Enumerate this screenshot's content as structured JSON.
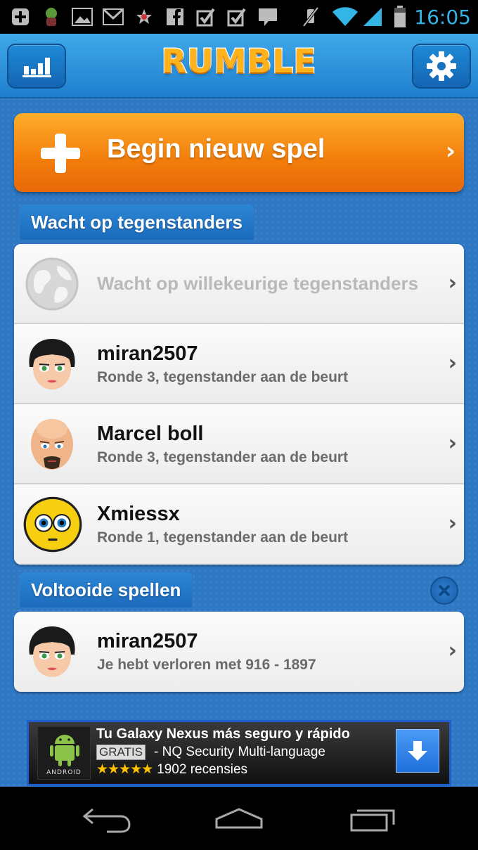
{
  "status_bar": {
    "time": "16:05",
    "icons": [
      "add-icon",
      "bug-icon",
      "image-icon",
      "gmail-icon",
      "star-icon",
      "facebook-icon",
      "checkbox-icon",
      "checkbox-icon",
      "chat-icon",
      "mute-icon",
      "wifi-icon",
      "signal-icon",
      "battery-icon"
    ]
  },
  "header": {
    "logo": "RUMBLE",
    "stats_icon": "stats-icon",
    "settings_icon": "gear-icon"
  },
  "new_game": {
    "label": "Begin nieuw spel"
  },
  "waiting_section": {
    "title": "Wacht op tegenstanders",
    "random_label": "Wacht op willekeurige tegenstanders",
    "games": [
      {
        "name": "miran2507",
        "status": "Ronde 3, tegenstander aan de beurt"
      },
      {
        "name": "Marcel boll",
        "status": "Ronde 3, tegenstander aan de beurt"
      },
      {
        "name": "Xmiessx",
        "status": "Ronde 1, tegenstander aan de beurt"
      }
    ]
  },
  "finished_section": {
    "title": "Voltooide spellen",
    "games": [
      {
        "name": "miran2507",
        "status": "Je hebt verloren met 916 - 1897"
      }
    ]
  },
  "ad": {
    "title": "Tu Galaxy Nexus más seguro y rápido",
    "badge": "GRATIS",
    "subtitle": "- NQ Security Multi-language",
    "stars": "★★★★★",
    "reviews": "1902 recensies",
    "icon_text": "ANDROID"
  },
  "colors": {
    "orange": "#f27d0b",
    "blue": "#2f78c4",
    "accent": "#33b5e5"
  }
}
